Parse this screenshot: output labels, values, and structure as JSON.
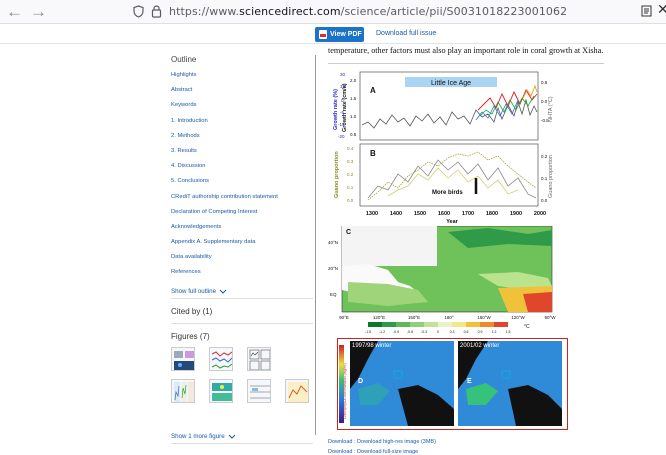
{
  "browser": {
    "url_prefix": "https://www.",
    "url_domain": "sciencedirect.com",
    "url_path": "/science/article/pii/S0031018223001062"
  },
  "toolbar": {
    "view_pdf": "View PDF",
    "download_issue": "Download full issue"
  },
  "article": {
    "text_line": "temperature, other factors must also play an important role in coral growth at Xisha."
  },
  "sidebar": {
    "outline_heading": "Outline",
    "outline_items": [
      "Highlights",
      "Abstract",
      "Keywords",
      "1. Introduction",
      "2. Methods",
      "3. Results",
      "4. Discussion",
      "5. Conclusions",
      "CRediT authorship contribution statement",
      "Declaration of Competing Interest",
      "Acknowledgements",
      "Appendix A. Supplementary data",
      "Data availability",
      "References"
    ],
    "show_full_outline": "Show full outline",
    "cited_by": "Cited by (1)",
    "figures_heading": "Figures (7)",
    "show_more_figure": "Show 1 more figure"
  },
  "figure": {
    "panel_a_label": "A",
    "panel_b_label": "B",
    "panel_c_label": "C",
    "panel_d_label": "D",
    "panel_e_label": "E",
    "little_ice_age": "Little Ice Age",
    "more_birds": "More birds",
    "ylabel_growth_rate_pct": "Growth rate (%)",
    "ylabel_growth_rate_cm": "Growth rate (cm/a)",
    "ylabel_nhta": "NHTA (°C)",
    "ylabel_guano_left": "Guano proportion",
    "ylabel_guano_right": "Guano proportion",
    "xlabel": "Year",
    "year_ticks": [
      "1300",
      "1400",
      "1500",
      "1600",
      "1700",
      "1800",
      "1900",
      "2000"
    ],
    "growth_pct_ticks": [
      "30",
      "15",
      "0",
      "-5",
      "-15",
      "-20"
    ],
    "growth_cm_ticks": [
      "2.0",
      "1.5",
      "1.0",
      "0.5"
    ],
    "nhta_ticks": [
      "0.5",
      "0.0",
      "-0.5"
    ],
    "guano_left_ticks": [
      "0.4",
      "0.3",
      "0.2",
      "0.1",
      "0.0"
    ],
    "guano_right_ticks": [
      "0.2",
      "0.1",
      "0.0"
    ],
    "map_lat_ticks": [
      "40°N",
      "20°N",
      "EQ"
    ],
    "map_lon_ticks": [
      "90°E",
      "120°E",
      "150°E",
      "180°",
      "150°W",
      "120°W",
      "90°W"
    ],
    "colorbar_ticks": [
      "-1.5",
      "-1.2",
      "-0.9",
      "-0.6",
      "-0.3",
      "0",
      "0.3",
      "0.6",
      "0.9",
      "1.2",
      "1.5"
    ],
    "colorbar_unit": "°C",
    "winter_1997": "1997/98 winter",
    "winter_2001": "2001/02 winter",
    "chlorophyll_label": "Chlorophyll-a concentration (mg/m³)"
  },
  "download": {
    "high_res": "Download : Download high-res image (3MB)",
    "full_size": "Download : Download full-size image"
  },
  "colors": {
    "link": "#1a5aa8",
    "pdf_button": "#1a73c7",
    "figure_border": "#cc2222"
  }
}
